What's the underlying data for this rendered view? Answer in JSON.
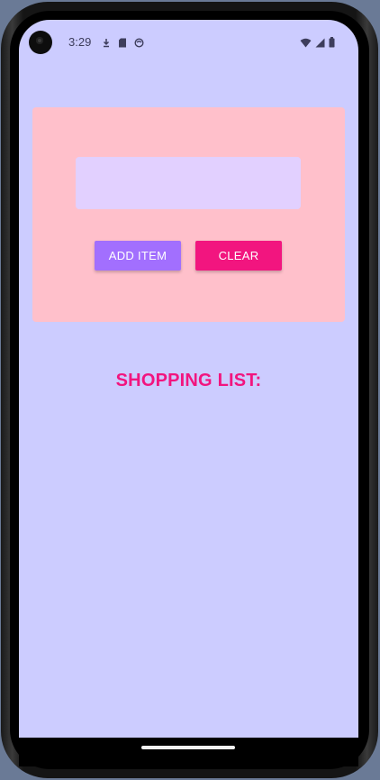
{
  "status_bar": {
    "time": "3:29",
    "left_icons": [
      "download-icon",
      "sd-card-icon",
      "sync-icon"
    ],
    "right_icons": [
      "wifi-icon",
      "cell-signal-icon",
      "battery-icon"
    ]
  },
  "form": {
    "item_input": {
      "value": "",
      "placeholder": ""
    },
    "add_label": "ADD ITEM",
    "clear_label": "CLEAR"
  },
  "list": {
    "title": "SHOPPING LIST:",
    "items": []
  },
  "colors": {
    "background": "#ccccff",
    "card": "#ffc0cb",
    "input_fill": "#e2d0ff",
    "add_button": "#a26ffe",
    "clear_button": "#f2157f",
    "title": "#f2157f"
  }
}
